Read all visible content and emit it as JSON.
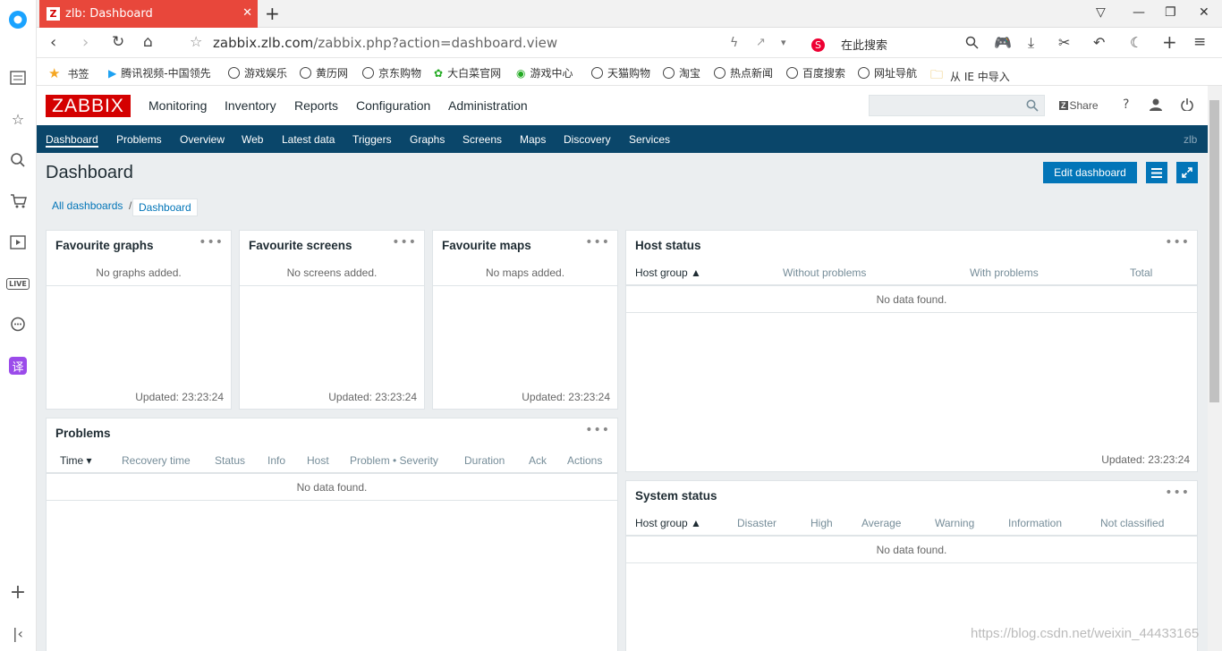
{
  "browser": {
    "tab_title": "zlb: Dashboard",
    "tab_favicon": "Z",
    "url_host": "zabbix.zlb.com",
    "url_path": "/zabbix.php?action=dashboard.view",
    "search_placeholder": "在此搜索",
    "bookmarks": [
      "书签",
      "腾讯视频-中国领先",
      "游戏娱乐",
      "黄历网",
      "京东购物",
      "大白菜官网",
      "游戏中心",
      "天猫购物",
      "淘宝",
      "热点新闻",
      "百度搜索",
      "网址导航",
      "从 IE 中导入"
    ]
  },
  "zabbix": {
    "logo": "ZABBIX",
    "main_menu": [
      "Monitoring",
      "Inventory",
      "Reports",
      "Configuration",
      "Administration"
    ],
    "share": "Share",
    "help": "?",
    "sub_menu": [
      "Dashboard",
      "Problems",
      "Overview",
      "Web",
      "Latest data",
      "Triggers",
      "Graphs",
      "Screens",
      "Maps",
      "Discovery",
      "Services"
    ],
    "user": "zlb",
    "page_title": "Dashboard",
    "edit_btn": "Edit dashboard",
    "breadcrumbs": [
      "All dashboards",
      "/",
      "Dashboard"
    ]
  },
  "widgets": {
    "fav_graphs": {
      "title": "Favourite graphs",
      "msg": "No graphs added.",
      "updated": "Updated: 23:23:24"
    },
    "fav_screens": {
      "title": "Favourite screens",
      "msg": "No screens added.",
      "updated": "Updated: 23:23:24"
    },
    "fav_maps": {
      "title": "Favourite maps",
      "msg": "No maps added.",
      "updated": "Updated: 23:23:24"
    },
    "host_status": {
      "title": "Host status",
      "cols": [
        "Host group ▲",
        "Without problems",
        "With problems",
        "Total"
      ],
      "msg": "No data found.",
      "updated": "Updated: 23:23:24"
    },
    "problems": {
      "title": "Problems",
      "cols": [
        "Time ▾",
        "Recovery time",
        "Status",
        "Info",
        "Host",
        "Problem • Severity",
        "Duration",
        "Ack",
        "Actions"
      ],
      "msg": "No data found."
    },
    "system_status": {
      "title": "System status",
      "cols": [
        "Host group ▲",
        "Disaster",
        "High",
        "Average",
        "Warning",
        "Information",
        "Not classified"
      ],
      "msg": "No data found."
    }
  },
  "watermark": "https://blog.csdn.net/weixin_44433165"
}
